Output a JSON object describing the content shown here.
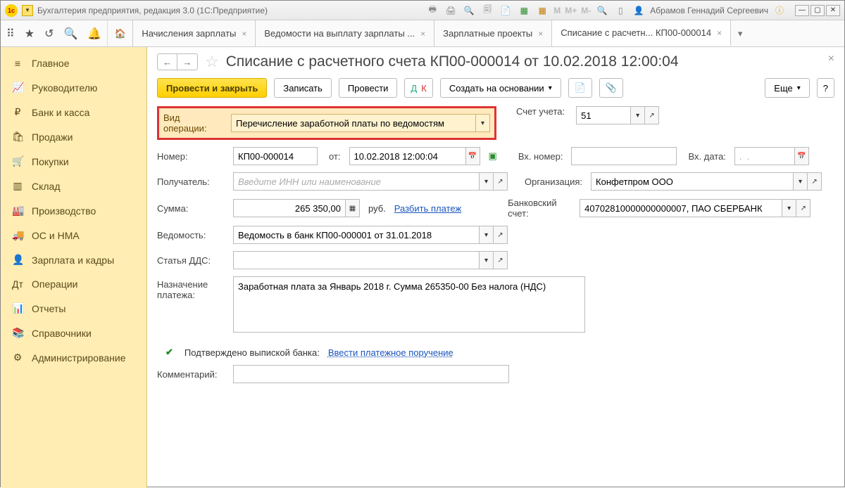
{
  "titlebar": {
    "app_title": "Бухгалтерия предприятия, редакция 3.0  (1С:Предприятие)",
    "user": "Абрамов Геннадий Сергеевич",
    "m_labels": [
      "M",
      "M+",
      "M-"
    ]
  },
  "tabs": [
    {
      "label": "Начисления зарплаты"
    },
    {
      "label": "Ведомости на выплату зарплаты ..."
    },
    {
      "label": "Зарплатные проекты"
    },
    {
      "label": "Списание с расчетн... КП00-000014",
      "active": true
    }
  ],
  "sidebar": {
    "items": [
      {
        "icon": "≡",
        "label": "Главное"
      },
      {
        "icon": "📈",
        "label": "Руководителю"
      },
      {
        "icon": "₽",
        "label": "Банк и касса"
      },
      {
        "icon": "🛍",
        "label": "Продажи"
      },
      {
        "icon": "🛒",
        "label": "Покупки"
      },
      {
        "icon": "▥",
        "label": "Склад"
      },
      {
        "icon": "🏭",
        "label": "Производство"
      },
      {
        "icon": "🚚",
        "label": "ОС и НМА"
      },
      {
        "icon": "👤",
        "label": "Зарплата и кадры"
      },
      {
        "icon": "Дт",
        "label": "Операции"
      },
      {
        "icon": "📊",
        "label": "Отчеты"
      },
      {
        "icon": "📚",
        "label": "Справочники"
      },
      {
        "icon": "⚙",
        "label": "Администрирование"
      }
    ]
  },
  "page": {
    "title": "Списание с расчетного счета КП00-000014 от 10.02.2018 12:00:04",
    "cmd": {
      "primary": "Провести и закрыть",
      "save": "Записать",
      "post": "Провести",
      "create_based": "Создать на основании",
      "more": "Еще",
      "help": "?"
    },
    "labels": {
      "op_type": "Вид операции:",
      "account": "Счет учета:",
      "number": "Номер:",
      "from": "от:",
      "ext_number": "Вх. номер:",
      "ext_date": "Вх. дата:",
      "recipient": "Получатель:",
      "org": "Организация:",
      "sum": "Сумма:",
      "sum_unit": "руб.",
      "split": "Разбить платеж",
      "bank_acc": "Банковский счет:",
      "register": "Ведомость:",
      "dds": "Статья ДДС:",
      "purpose": "Назначение платежа:",
      "confirmed": "Подтверждено выпиской банка:",
      "enter_po": "Ввести платежное поручение",
      "comment": "Комментарий:"
    },
    "values": {
      "op_type": "Перечисление заработной платы по ведомостям",
      "account": "51",
      "number": "КП00-000014",
      "date": "10.02.2018 12:00:04",
      "ext_date_placeholder": ".  .",
      "recipient_placeholder": "Введите ИНН или наименование",
      "org": "Конфетпром ООО",
      "sum": "265 350,00",
      "bank_acc": "40702810000000000007, ПАО СБЕРБАНК",
      "register": "Ведомость в банк КП00-000001 от 31.01.2018",
      "purpose": "Заработная плата за Январь 2018 г. Сумма 265350-00 Без налога (НДС)"
    }
  }
}
